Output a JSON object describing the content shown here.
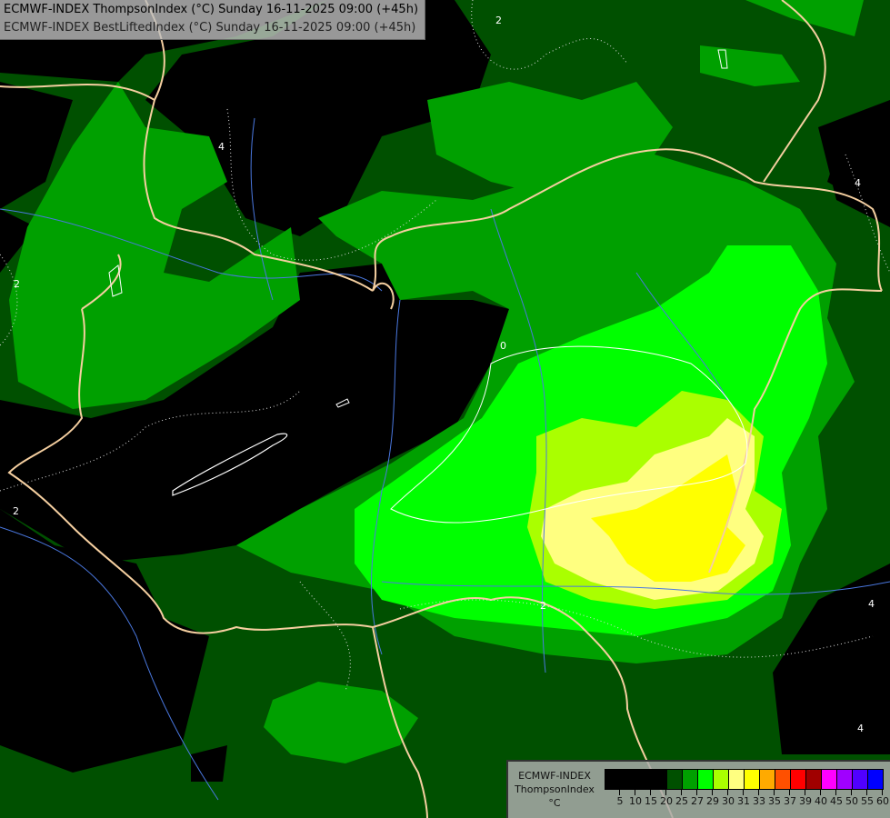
{
  "header": {
    "line1": "ECMWF-INDEX ThompsonIndex (°C) Sunday 16-11-2025 09:00 (+45h)",
    "line2": "ECMWF-INDEX BestLiftedIndex (°C) Sunday 16-11-2025 09:00 (+45h)"
  },
  "contour_labels": [
    "2",
    "4",
    "2",
    "0",
    "2",
    "2",
    "4",
    "4",
    "4"
  ],
  "legend": {
    "line1": "ECMWF-INDEX",
    "line2": "ThompsonIndex",
    "unit": "°C",
    "colors": [
      "#000000",
      "#000000",
      "#000000",
      "#000000",
      "#005000",
      "#00a000",
      "#00ff00",
      "#aaff00",
      "#ffff80",
      "#ffff00",
      "#ffaa00",
      "#ff5000",
      "#ff0000",
      "#a00000",
      "#ff00ff",
      "#a000ff",
      "#5000ff",
      "#0000ff"
    ],
    "ticks": [
      "5",
      "10",
      "15",
      "20",
      "25",
      "27",
      "29",
      "30",
      "31",
      "33",
      "35",
      "37",
      "39",
      "40",
      "45",
      "50",
      "55",
      "60"
    ]
  }
}
